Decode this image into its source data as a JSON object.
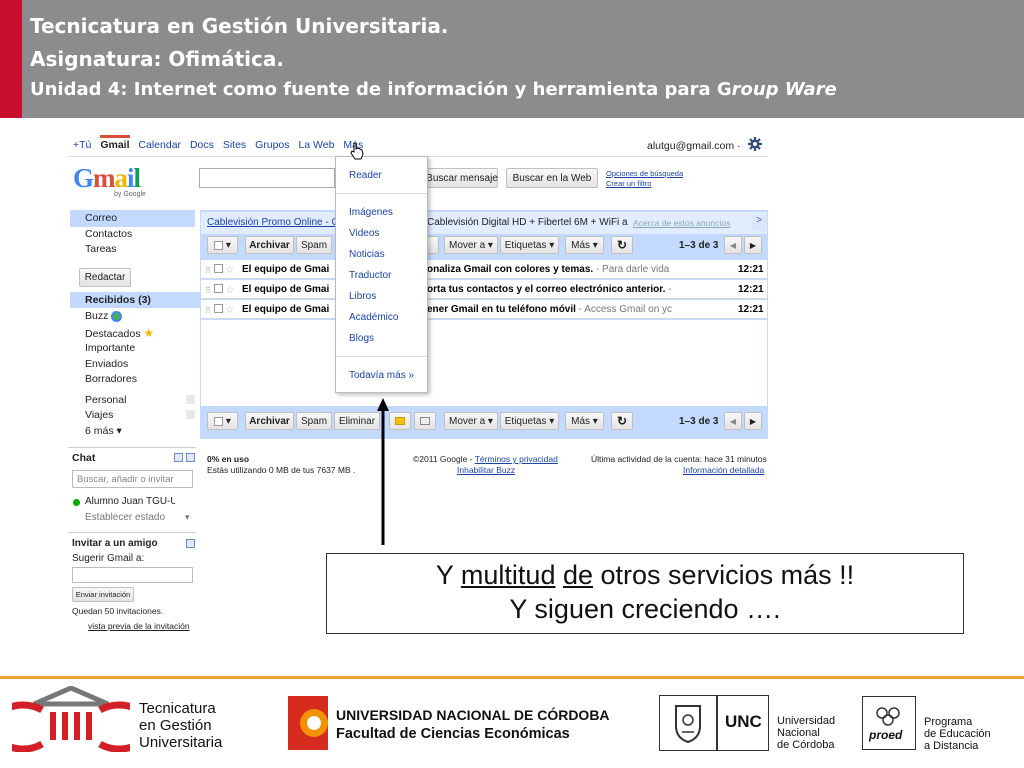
{
  "header": {
    "line1": "Tecnicatura en Gestión Universitaria.",
    "line2": "Asignatura: Ofimática.",
    "line3_start": "Unidad 4: Internet como fuente de información y herramienta para G",
    "line3_italic": "roup Ware"
  },
  "gmail": {
    "topnav": [
      "+Tú",
      "Gmail",
      "Calendar",
      "Docs",
      "Sites",
      "Grupos",
      "La Web",
      "Más"
    ],
    "account": "alutgu@gmail.com ·",
    "logo": "Gmail",
    "logo_sub": "by Google",
    "search_btn": "Buscar mensaje",
    "search_web_btn": "Buscar en la Web",
    "search_options": "Opciones de búsqueda",
    "create_filter": "Crear un filtro",
    "sidebar_top": [
      "Correo",
      "Contactos",
      "Tareas"
    ],
    "compose": "Redactar",
    "folders": [
      "Recibidos (3)",
      "Buzz",
      "Destacados",
      "Importante",
      "Enviados",
      "Borradores"
    ],
    "labels": [
      "Personal",
      "Viajes",
      "6 más ▾"
    ],
    "chat_title": "Chat",
    "chat_search_placeholder": "Buscar, añadir o invitar",
    "chat_user": "Alumno Juan TGU-U",
    "chat_status": "Establecer estado",
    "invite_title": "Invitar a un amigo",
    "invite_label": "Sugerir Gmail a:",
    "invite_btn": "Enviar invitación",
    "invite_remaining": "Quedan 50 invitaciones.",
    "invite_preview": "vista previa de la invitación",
    "ad_left": "Cablevisión Promo Online - C",
    "ad_right": "Cablevisión Digital HD + Fibertel 6M + WiFi a",
    "ad_about": "Acerca de estos anuncios",
    "toolbar": {
      "archive": "Archivar",
      "spam": "Spam",
      "delete": "Eliminar",
      "move": "Mover a ▾",
      "labels": "Etiquetas ▾",
      "more": "Más ▾",
      "count": "1–3 de 3"
    },
    "emails": [
      {
        "sender": "El equipo de Gmai",
        "subject": "onaliza Gmail con colores y temas.",
        "snippet": " - Para darle vida",
        "time": "12:21"
      },
      {
        "sender": "El equipo de Gmai",
        "subject": "orta tus contactos y el correo electrónico anterior.",
        "snippet": " -",
        "time": "12:21"
      },
      {
        "sender": "El equipo de Gmai",
        "subject": "ener Gmail en tu teléfono móvil",
        "snippet": " - Access Gmail on yc",
        "time": "12:21"
      }
    ],
    "footer_usage": "0% en uso",
    "footer_usage_detail": "Estás utilizando 0 MB de tus 7637 MB .",
    "footer_copyright": "©2011 Google - ",
    "footer_terms": "Términos y privacidad",
    "footer_disable_buzz": "Inhabilitar Buzz",
    "footer_activity": "Última actividad de la cuenta: hace 31 minutos",
    "footer_details": "Información detallada",
    "menu_items": [
      "Reader",
      "Imágenes",
      "Videos",
      "Noticias",
      "Traductor",
      "Libros",
      "Académico",
      "Blogs"
    ],
    "menu_more": "Todavía más »"
  },
  "callout": {
    "l1_a": "Y ",
    "l1_b": "multitud",
    "l1_c": " ",
    "l1_d": "de",
    "l1_e": " otros servicios más !!",
    "l2": "Y siguen creciendo …."
  },
  "footer": {
    "tgu": [
      "Tecnicatura",
      "en Gestión",
      "Universitaria"
    ],
    "unc_line1": "UNIVERSIDAD NACIONAL DE CÓRDOBA",
    "unc_line2": "Facultad de Ciencias Económicas",
    "unc_badge": "UNC",
    "unc_name": [
      "Universidad",
      "Nacional",
      "de Córdoba"
    ],
    "proed_badge": "proed",
    "proed_name": [
      "Programa",
      "de Educación",
      "a Distancia"
    ]
  },
  "colors": {
    "header_bg": "#8b8c8e",
    "header_accent": "#c8102e",
    "gmail_blue": "#c3d9ff",
    "link": "#1a44a8",
    "footer_line": "#f0a030"
  }
}
